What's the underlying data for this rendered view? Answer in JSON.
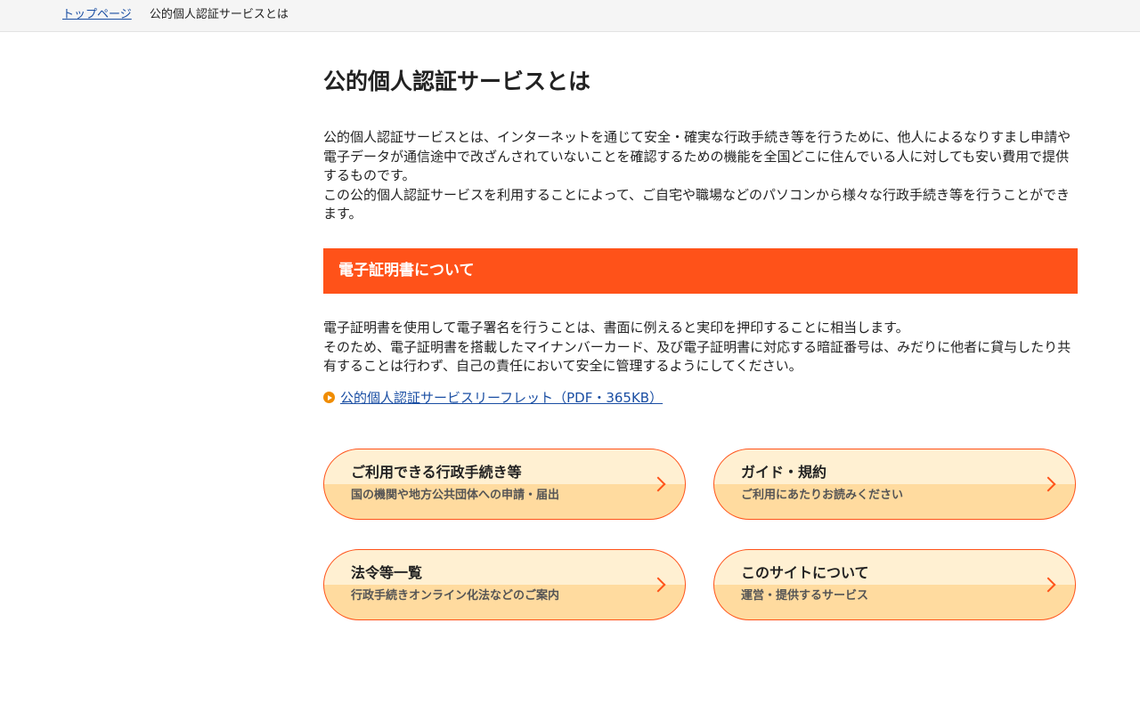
{
  "breadcrumb": {
    "home_label": "トップページ",
    "current_label": "公的個人認証サービスとは"
  },
  "page": {
    "title": "公的個人認証サービスとは",
    "intro_paragraphs": [
      "公的個人認証サービスとは、インターネットを通じて安全・確実な行政手続き等を行うために、他人によるなりすまし申請や電子データが通信途中で改ざんされていないことを確認するための機能を全国どこに住んでいる人に対しても安い費用で提供するものです。",
      "この公的個人認証サービスを利用することによって、ご自宅や職場などのパソコンから様々な行政手続き等を行うことができます。"
    ]
  },
  "section": {
    "heading": "電子証明書について",
    "paragraphs": [
      "電子証明書を使用して電子署名を行うことは、書面に例えると実印を押印することに相当します。",
      "そのため、電子証明書を搭載したマイナンバーカード、及び電子証明書に対応する暗証番号は、みだりに他者に貸与したり共有することは行わず、自己の責任において安全に管理するようにしてください。"
    ],
    "leaflet_link": "公的個人認証サービスリーフレット（PDF・365KB）"
  },
  "cards": [
    {
      "title": "ご利用できる行政手続き等",
      "subtitle": "国の機関や地方公共団体への申請・届出"
    },
    {
      "title": "ガイド・規約",
      "subtitle": "ご利用にあたりお読みください"
    },
    {
      "title": "法令等一覧",
      "subtitle": "行政手続きオンライン化法などのご案内"
    },
    {
      "title": "このサイトについて",
      "subtitle": "運営・提供するサービス"
    }
  ],
  "colors": {
    "accent": "#ff5219",
    "link": "#1a4ea3",
    "card_top": "#fff0d2",
    "card_bottom": "#ffdb9f",
    "bullet": "#f08c00"
  }
}
